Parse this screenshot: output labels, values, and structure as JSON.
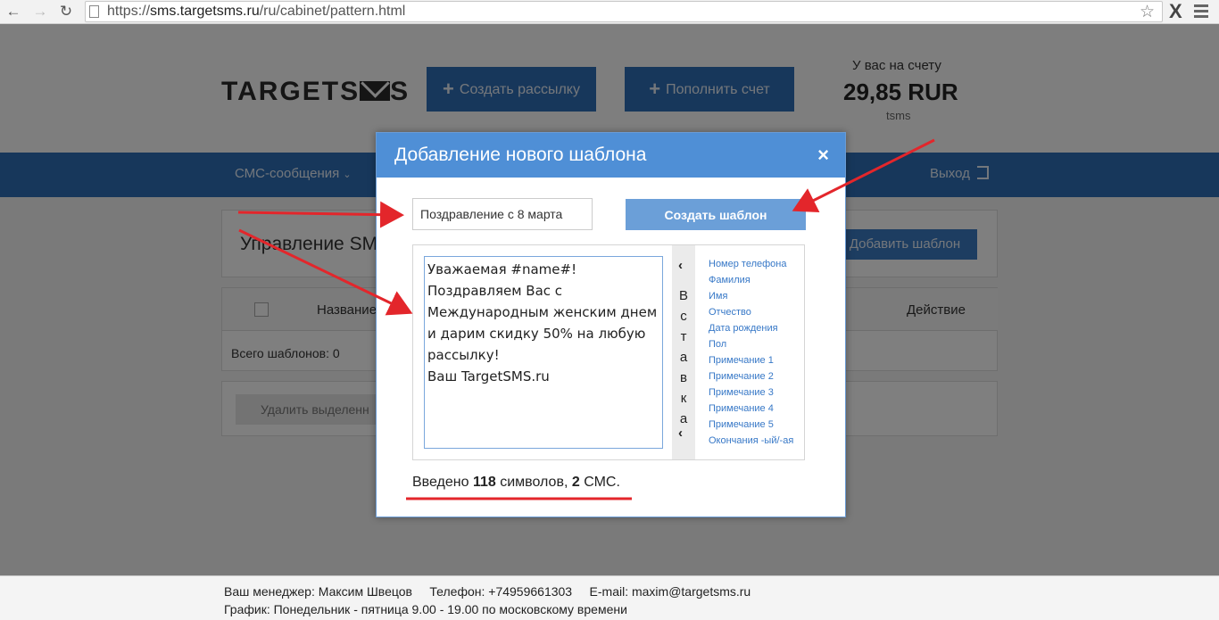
{
  "browser": {
    "url_prefix": "https://",
    "url_host": "sms.targetsms.ru",
    "url_path": "/ru/cabinet/pattern.html"
  },
  "header": {
    "logo_text": "TARGETS",
    "logo_tail": "S",
    "create_mailing": "Создать рассылку",
    "top_up": "Пополнить счет",
    "balance_label": "У вас на счету",
    "balance_amount": "29,85 RUR",
    "balance_unit": "tsms"
  },
  "nav": {
    "sms_messages": "СМС-сообщения",
    "exit": "Выход"
  },
  "page": {
    "title": "Управление SM",
    "add_template": "Добавить шаблон",
    "col_name": "Название",
    "col_action": "Действие",
    "total": "Всего шаблонов: 0",
    "delete_selected": "Удалить выделенн"
  },
  "modal": {
    "title": "Добавление нового шаблона",
    "close": "×",
    "name_value": "Поздравление с 8 марта",
    "create_button": "Создать шаблон",
    "message_text": "Уважаемая #name#!\nПоздравляем Вас с Международным женским днем и дарим скидку 50% на любую рассылку!\nВаш TargetSMS.ru",
    "insert_label_letters": [
      "В",
      "с",
      "т",
      "а",
      "в",
      "к",
      "а"
    ],
    "variables": [
      "Номер телефона",
      "Фамилия",
      "Имя",
      "Отчество",
      "Дата рождения",
      "Пол",
      "Примечание 1",
      "Примечание 2",
      "Примечание 3",
      "Примечание 4",
      "Примечание 5",
      "Окончания -ый/-ая"
    ],
    "counter_prefix": "Введено",
    "counter_chars": "118",
    "counter_middle": "символов,",
    "counter_sms": "2",
    "counter_suffix": "СМС."
  },
  "footer": {
    "line1": "Ваш менеджер: Максим Швецов     Телефон: +74959661303     E-mail: maxim@targetsms.ru",
    "line2": "График: Понедельник - пятница 9.00 - 19.00 по московскому времени"
  },
  "colors": {
    "brand_blue": "#2f6fb7",
    "modal_header": "#4f8fd6",
    "annotation_red": "#e3262b"
  }
}
